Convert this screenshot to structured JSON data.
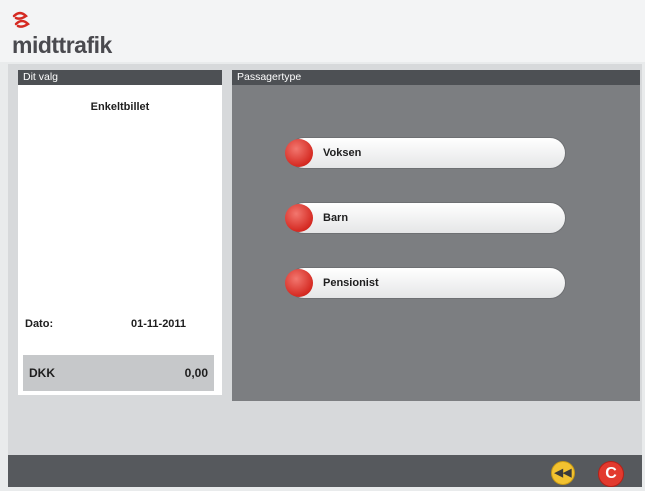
{
  "brand": {
    "name": "midttrafik"
  },
  "left_panel": {
    "title": "Dit valg",
    "ticket": "Enkeltbillet",
    "date_label": "Dato:",
    "date_value": "01-11-2011",
    "currency": "DKK",
    "amount": "0,00"
  },
  "right_panel": {
    "title": "Passagertype",
    "options": [
      {
        "label": "Voksen"
      },
      {
        "label": "Barn"
      },
      {
        "label": "Pensionist"
      }
    ]
  },
  "buttons": {
    "back_icon": "rewind-icon",
    "cancel_label": "C"
  },
  "colors": {
    "accent_red": "#d52a22",
    "back_yellow": "#f2c230",
    "panel_header": "#4d5054",
    "panel_body": "#7c7e81"
  }
}
